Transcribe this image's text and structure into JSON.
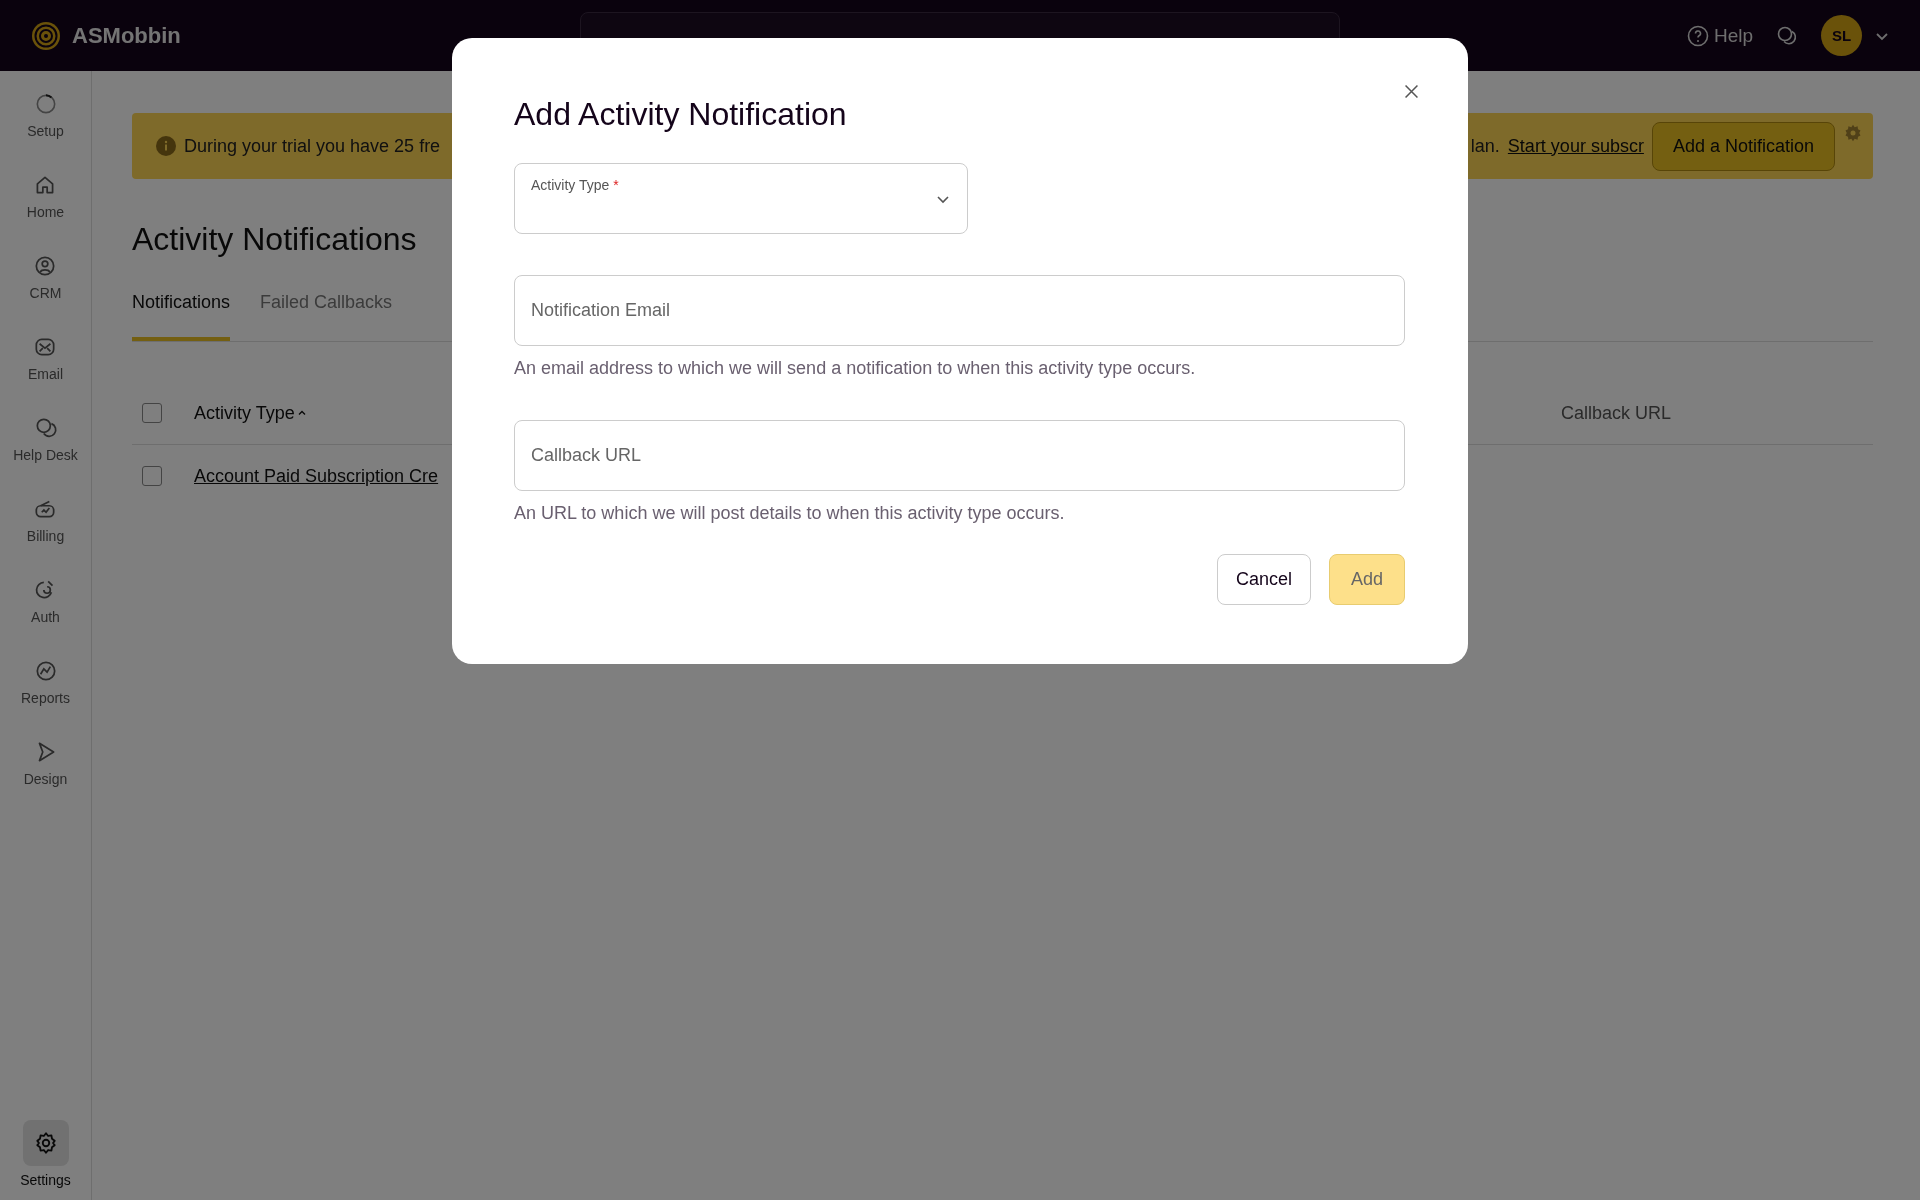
{
  "topbar": {
    "brand": "ASMobbin",
    "help": "Help",
    "avatar": "SL"
  },
  "sidebar": {
    "items": [
      {
        "label": "Setup",
        "selected": false
      },
      {
        "label": "Home",
        "selected": false
      },
      {
        "label": "CRM",
        "selected": false
      },
      {
        "label": "Email",
        "selected": false
      },
      {
        "label": "Help Desk",
        "selected": false
      },
      {
        "label": "Billing",
        "selected": false
      },
      {
        "label": "Auth",
        "selected": false
      },
      {
        "label": "Reports",
        "selected": false
      },
      {
        "label": "Design",
        "selected": false
      }
    ],
    "footer": {
      "label": "Settings",
      "selected": true
    }
  },
  "banner": {
    "text_start": "During your trial you have 25 fre",
    "text_end": "lan.",
    "link": "Start your subscr",
    "button": "Add a Notification"
  },
  "page": {
    "title": "Activity Notifications"
  },
  "tabs": [
    {
      "label": "Notifications",
      "selected": true
    },
    {
      "label": "Failed Callbacks",
      "selected": false
    }
  ],
  "table": {
    "columns": [
      {
        "label": "Activity Type",
        "sorted": true
      },
      {
        "label": "Callback URL",
        "sorted": false
      }
    ],
    "rows": [
      {
        "checked": false,
        "activity_type": "Account Paid Subscription Cre"
      }
    ],
    "header_checked": false
  },
  "modal": {
    "title": "Add Activity Notification",
    "select": {
      "label": "Activity Type",
      "required_mark": "*"
    },
    "fields": [
      {
        "placeholder": "Notification Email",
        "help": "An email address to which we will send a notification to when this activity type occurs."
      },
      {
        "placeholder": "Callback URL",
        "help": "An URL to which we will post details to when this activity type occurs."
      }
    ],
    "buttons": [
      {
        "label": "Cancel",
        "kind": "secondary",
        "disabled": false
      },
      {
        "label": "Add",
        "kind": "primary",
        "disabled": true
      }
    ]
  }
}
